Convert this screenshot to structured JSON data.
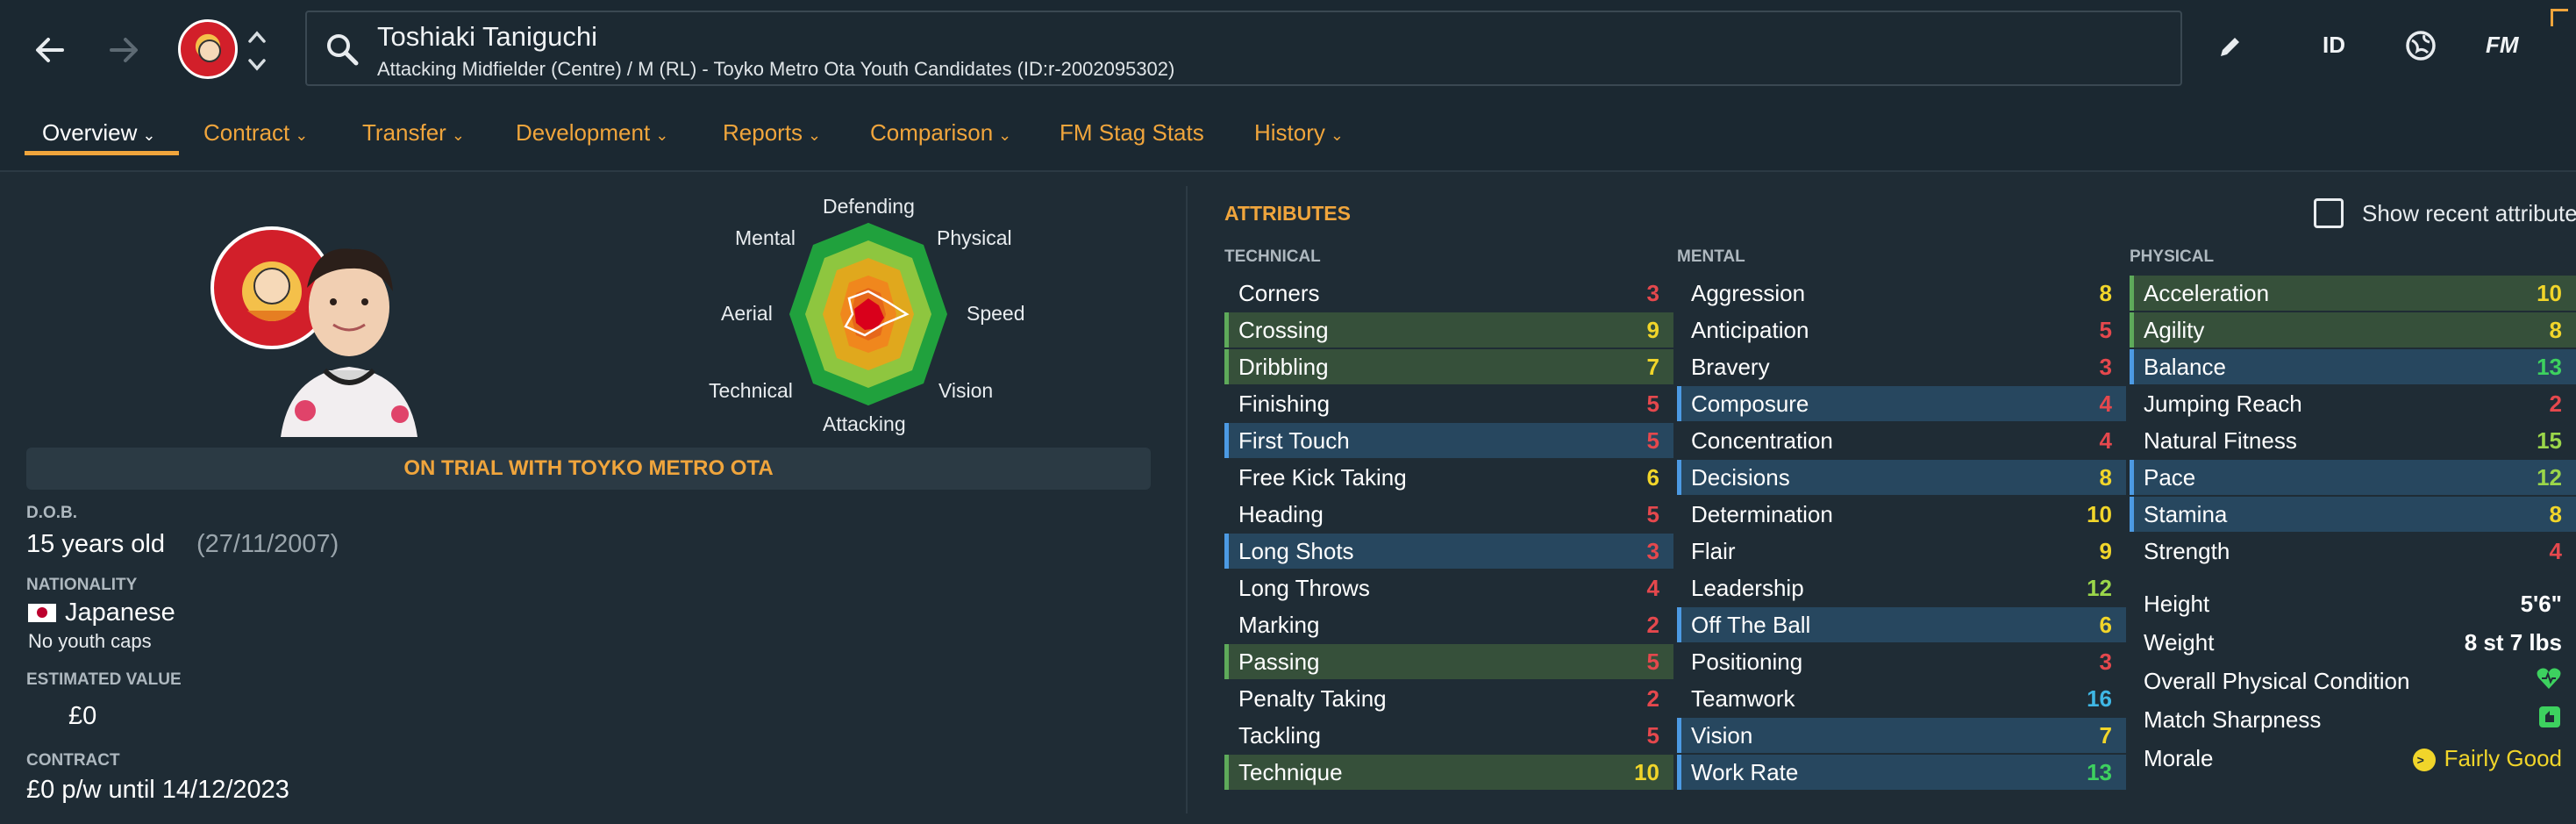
{
  "header": {
    "player_name": "Toshiaki Taniguchi",
    "player_subtitle": "Attacking Midfielder (Centre) / M (RL) - Toyko Metro Ota Youth Candidates (ID:r-2002095302)",
    "id_label": "ID",
    "fm_label": "FM"
  },
  "tabs": [
    {
      "label": "Overview"
    },
    {
      "label": "Contract"
    },
    {
      "label": "Transfer"
    },
    {
      "label": "Development"
    },
    {
      "label": "Reports"
    },
    {
      "label": "Comparison"
    },
    {
      "label": "FM Stag Stats"
    },
    {
      "label": "History"
    }
  ],
  "radar": {
    "labels": {
      "defending": "Defending",
      "physical": "Physical",
      "speed": "Speed",
      "vision": "Vision",
      "attacking": "Attacking",
      "technical": "Technical",
      "aerial": "Aerial",
      "mental": "Mental"
    }
  },
  "profile": {
    "trial_banner": "ON TRIAL WITH TOYKO METRO OTA",
    "dob_label": "D.O.B.",
    "age": "15 years old",
    "dob": "(27/11/2007)",
    "nationality_label": "NATIONALITY",
    "nationality": "Japanese",
    "caps": "No youth caps",
    "value_label": "ESTIMATED VALUE",
    "value": "£0",
    "contract_label": "CONTRACT",
    "contract": "£0 p/w until 14/12/2023"
  },
  "attributes": {
    "title": "ATTRIBUTES",
    "show_recent": "Show recent attributes",
    "technical_title": "TECHNICAL",
    "mental_title": "MENTAL",
    "physical_title": "PHYSICAL",
    "technical": [
      {
        "name": "Corners",
        "value": "3"
      },
      {
        "name": "Crossing",
        "value": "9"
      },
      {
        "name": "Dribbling",
        "value": "7"
      },
      {
        "name": "Finishing",
        "value": "5"
      },
      {
        "name": "First Touch",
        "value": "5"
      },
      {
        "name": "Free Kick Taking",
        "value": "6"
      },
      {
        "name": "Heading",
        "value": "5"
      },
      {
        "name": "Long Shots",
        "value": "3"
      },
      {
        "name": "Long Throws",
        "value": "4"
      },
      {
        "name": "Marking",
        "value": "2"
      },
      {
        "name": "Passing",
        "value": "5"
      },
      {
        "name": "Penalty Taking",
        "value": "2"
      },
      {
        "name": "Tackling",
        "value": "5"
      },
      {
        "name": "Technique",
        "value": "10"
      }
    ],
    "mental": [
      {
        "name": "Aggression",
        "value": "8"
      },
      {
        "name": "Anticipation",
        "value": "5"
      },
      {
        "name": "Bravery",
        "value": "3"
      },
      {
        "name": "Composure",
        "value": "4"
      },
      {
        "name": "Concentration",
        "value": "4"
      },
      {
        "name": "Decisions",
        "value": "8"
      },
      {
        "name": "Determination",
        "value": "10"
      },
      {
        "name": "Flair",
        "value": "9"
      },
      {
        "name": "Leadership",
        "value": "12"
      },
      {
        "name": "Off The Ball",
        "value": "6"
      },
      {
        "name": "Positioning",
        "value": "3"
      },
      {
        "name": "Teamwork",
        "value": "16"
      },
      {
        "name": "Vision",
        "value": "7"
      },
      {
        "name": "Work Rate",
        "value": "13"
      }
    ],
    "physical": [
      {
        "name": "Acceleration",
        "value": "10"
      },
      {
        "name": "Agility",
        "value": "8"
      },
      {
        "name": "Balance",
        "value": "13"
      },
      {
        "name": "Jumping Reach",
        "value": "2"
      },
      {
        "name": "Natural Fitness",
        "value": "15"
      },
      {
        "name": "Pace",
        "value": "12"
      },
      {
        "name": "Stamina",
        "value": "8"
      },
      {
        "name": "Strength",
        "value": "4"
      }
    ],
    "physical_info": [
      {
        "name": "Height",
        "value": "5'6\""
      },
      {
        "name": "Weight",
        "value": "8 st 7 lbs"
      },
      {
        "name": "Overall Physical Condition",
        "value": ""
      },
      {
        "name": "Match Sharpness",
        "value": ""
      },
      {
        "name": "Morale",
        "value": "Fairly Good"
      }
    ]
  },
  "colors": {
    "accent": "#f0a53c",
    "background": "#1f2c35",
    "red": "#e5484d",
    "orange": "#f28c2b",
    "yellow": "#f1d52a",
    "light_green": "#9bd64a",
    "green": "#3dd15f",
    "blue": "#3fb7e5"
  }
}
